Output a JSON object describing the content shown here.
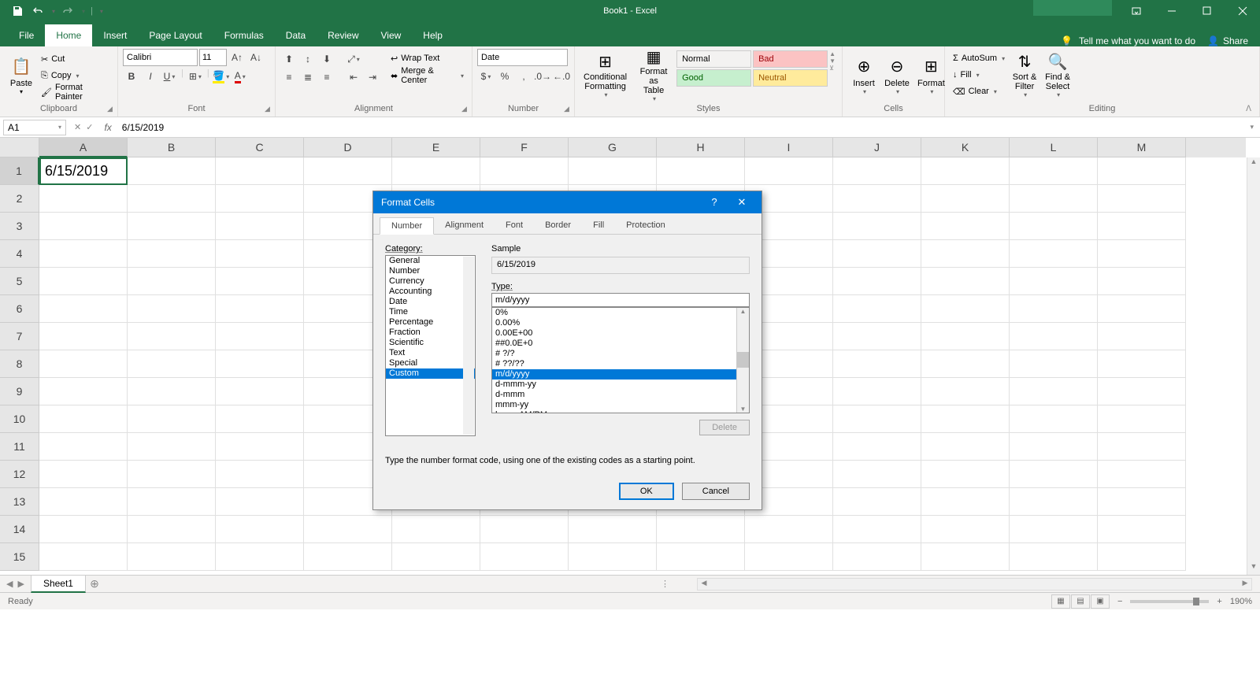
{
  "titlebar": {
    "title": "Book1 - Excel",
    "share": "Share"
  },
  "tabs": [
    "File",
    "Home",
    "Insert",
    "Page Layout",
    "Formulas",
    "Data",
    "Review",
    "View",
    "Help"
  ],
  "active_tab": "Home",
  "tell_me": "Tell me what you want to do",
  "ribbon": {
    "clipboard": {
      "label": "Clipboard",
      "paste": "Paste",
      "cut": "Cut",
      "copy": "Copy",
      "painter": "Format Painter"
    },
    "font": {
      "label": "Font",
      "name": "Calibri",
      "size": "11"
    },
    "alignment": {
      "label": "Alignment",
      "wrap": "Wrap Text",
      "merge": "Merge & Center"
    },
    "number": {
      "label": "Number",
      "format": "Date"
    },
    "styles": {
      "label": "Styles",
      "conditional": "Conditional\nFormatting",
      "table": "Format as\nTable",
      "s1": "Normal",
      "s2": "Bad",
      "s3": "Good",
      "s4": "Neutral"
    },
    "cells": {
      "label": "Cells",
      "insert": "Insert",
      "delete": "Delete",
      "format": "Format"
    },
    "editing": {
      "label": "Editing",
      "autosum": "AutoSum",
      "fill": "Fill",
      "clear": "Clear",
      "sort": "Sort &\nFilter",
      "find": "Find &\nSelect"
    }
  },
  "formula_bar": {
    "name": "A1",
    "formula": "6/15/2019"
  },
  "grid": {
    "columns": [
      "A",
      "B",
      "C",
      "D",
      "E",
      "F",
      "G",
      "H",
      "I",
      "J",
      "K",
      "L",
      "M"
    ],
    "row_count": 15,
    "active_cell_value": "6/15/2019"
  },
  "sheet": {
    "name": "Sheet1"
  },
  "status": {
    "ready": "Ready",
    "zoom": "190%"
  },
  "dialog": {
    "title": "Format Cells",
    "tabs": [
      "Number",
      "Alignment",
      "Font",
      "Border",
      "Fill",
      "Protection"
    ],
    "active_tab": "Number",
    "category_label": "Category:",
    "categories": [
      "General",
      "Number",
      "Currency",
      "Accounting",
      "Date",
      "Time",
      "Percentage",
      "Fraction",
      "Scientific",
      "Text",
      "Special",
      "Custom"
    ],
    "selected_category": "Custom",
    "sample_label": "Sample",
    "sample_value": "6/15/2019",
    "type_label": "Type:",
    "type_value": "m/d/yyyy",
    "type_list": [
      "0%",
      "0.00%",
      "0.00E+00",
      "##0.0E+0",
      "# ?/?",
      "# ??/??",
      "m/d/yyyy",
      "d-mmm-yy",
      "d-mmm",
      "mmm-yy",
      "h:mm AM/PM"
    ],
    "type_selected": "m/d/yyyy",
    "delete": "Delete",
    "hint": "Type the number format code, using one of the existing codes as a starting point.",
    "ok": "OK",
    "cancel": "Cancel"
  }
}
